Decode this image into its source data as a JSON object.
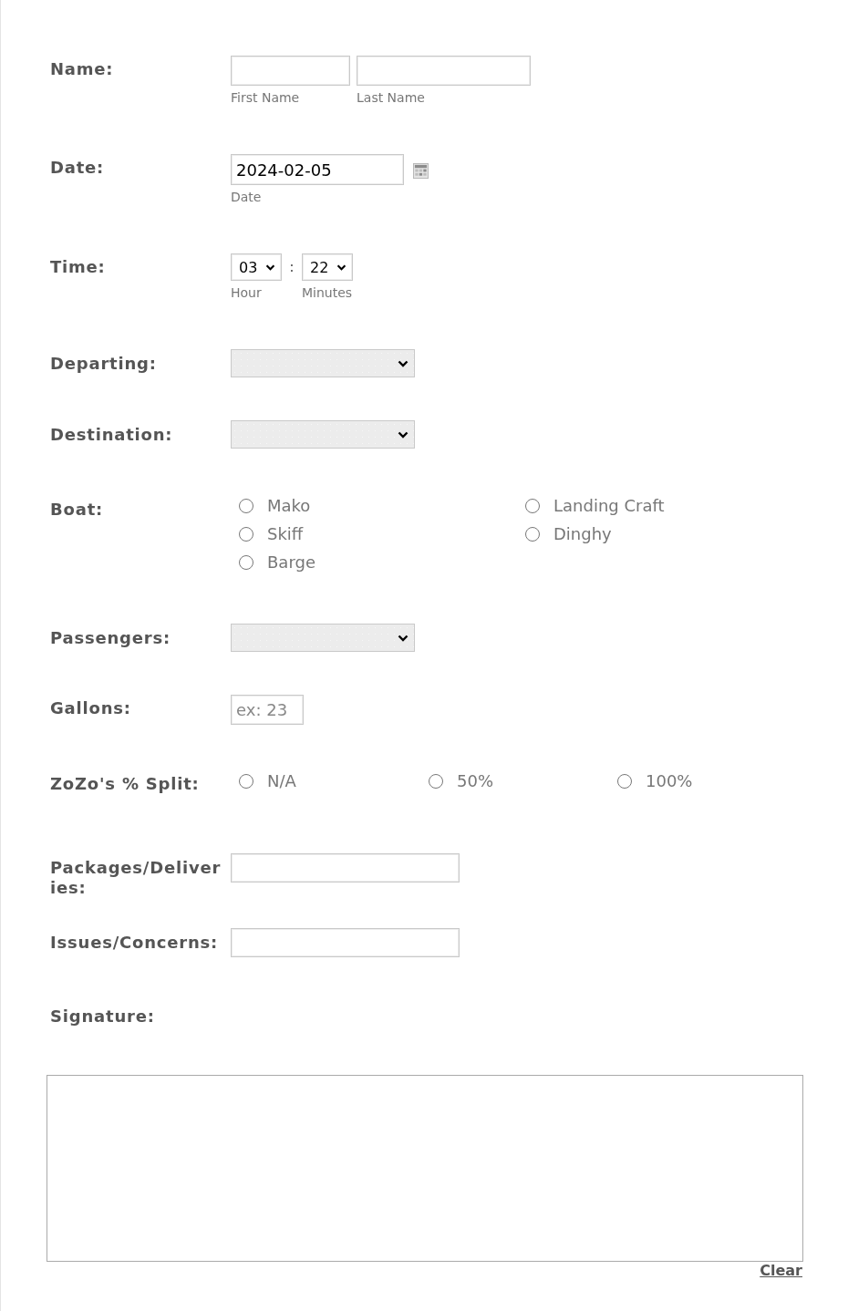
{
  "fields": [
    {
      "kind": "name",
      "label": "Name:",
      "parts": [
        {
          "hint": "First Name"
        },
        {
          "hint": "Last Name"
        }
      ]
    },
    {
      "kind": "date",
      "label": "Date:",
      "value": "2024-02-05",
      "hint": "Date"
    },
    {
      "kind": "time",
      "label": "Time:",
      "hour": {
        "value": "03",
        "hint": "Hour"
      },
      "separator": ":",
      "minutes": {
        "value": "22",
        "hint": "Minutes"
      }
    },
    {
      "kind": "select",
      "label": "Departing:"
    },
    {
      "kind": "select",
      "label": "Destination:"
    },
    {
      "kind": "radio_grid",
      "label": "Boat:",
      "options": [
        {
          "label": "Mako",
          "selected": false
        },
        {
          "label": "Skiff",
          "selected": false
        },
        {
          "label": "Barge",
          "selected": false
        },
        {
          "label": "Landing Craft",
          "selected": false
        },
        {
          "label": "Dinghy",
          "selected": false
        }
      ]
    },
    {
      "kind": "select",
      "label": "Passengers:"
    },
    {
      "kind": "number",
      "label": "Gallons:",
      "placeholder": "ex: 23"
    },
    {
      "kind": "radio_row",
      "label": "ZoZo's % Split:",
      "options": [
        {
          "label": "N/A",
          "selected": false
        },
        {
          "label": "50%",
          "selected": false
        },
        {
          "label": "100%",
          "selected": false
        }
      ]
    },
    {
      "kind": "text",
      "label": "Packages/Deliveries:"
    },
    {
      "kind": "text",
      "label": "Issues/Concerns:"
    },
    {
      "kind": "signature",
      "label": "Signature:",
      "clear_label": "Clear"
    }
  ]
}
